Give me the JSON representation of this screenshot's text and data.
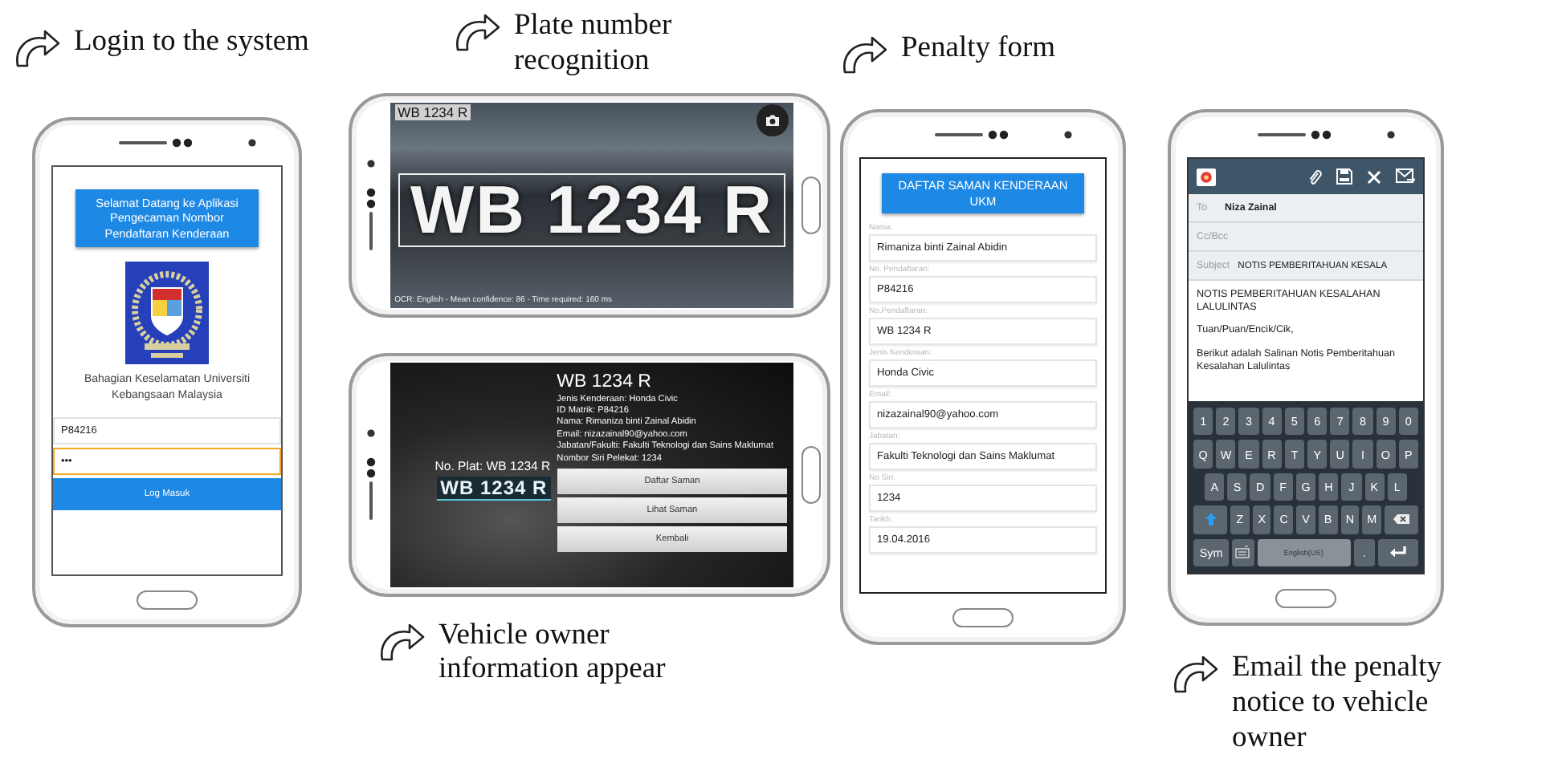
{
  "login": {
    "caption": "Login to the system",
    "banner": "Selamat Datang ke Aplikasi Pengecaman Nombor Pendaftaran Kenderaan",
    "organization": "Bahagian Keselamatan Universiti Kebangsaan Malaysia",
    "fields": [
      {
        "value": "P84216",
        "focused": false
      },
      {
        "value": "•••",
        "focused": true
      }
    ],
    "button": "Log Masuk"
  },
  "recognition": {
    "caption": "Plate number\nrecognition",
    "result_label": "WB 1234 R",
    "plate": "WB 1234 R",
    "status": "OCR: English - Mean confidence: 86 - Time required: 160 ms"
  },
  "owner_info": {
    "caption": "Vehicle owner\ninformation appear",
    "plate_label": "No. Plat: WB 1234 R",
    "plate_crop": "WB 1234 R",
    "title": "WB 1234 R",
    "details": [
      "Jenis Kenderaan: Honda Civic",
      "ID Matrik: P84216",
      "Nama: Rimaniza binti Zainal Abidin",
      "Email: nizazainal90@yahoo.com",
      "Jabatan/Fakulti: Fakulti Teknologi dan Sains Maklumat",
      "Nombor Siri Pelekat: 1234"
    ],
    "buttons": [
      "Daftar Saman",
      "Lihat Saman",
      "Kembali"
    ]
  },
  "penalty_form": {
    "caption": "Penalty form",
    "title": "DAFTAR SAMAN KENDERAAN UKM",
    "fields": [
      {
        "label": "Nama:",
        "value": "Rimaniza binti Zainal Abidin"
      },
      {
        "label": "No. Pendaftaran:",
        "value": "P84216"
      },
      {
        "label": "No.Pendaftaran:",
        "value": "WB 1234 R"
      },
      {
        "label": "Jenis Kenderaan:",
        "value": "Honda Civic"
      },
      {
        "label": "Email:",
        "value": "nizazainal90@yahoo.com"
      },
      {
        "label": "Jabatan:",
        "value": "Fakulti Teknologi dan Sains Maklumat"
      },
      {
        "label": "No Siri:",
        "value": "1234"
      },
      {
        "label": "Tarikh:",
        "value": "19.04.2016"
      }
    ]
  },
  "email": {
    "caption": "Email the penalty\nnotice to vehicle\nowner",
    "to_label": "To",
    "to": "Niza Zainal",
    "cc_label": "Cc/Bcc",
    "subject_label": "Subject",
    "subject": "NOTIS PEMBERITAHUAN KESALA",
    "body": [
      "NOTIS PEMBERITAHUAN KESALAHAN LALULINTAS",
      "Tuan/Puan/Encik/Cik,",
      "Berikut adalah Salinan Notis Pemberitahuan Kesalahan Lalulintas"
    ],
    "keyboard": [
      [
        {
          "kind": "char",
          "label": "1"
        },
        {
          "kind": "char",
          "label": "2"
        },
        {
          "kind": "char",
          "label": "3"
        },
        {
          "kind": "char",
          "label": "4"
        },
        {
          "kind": "char",
          "label": "5"
        },
        {
          "kind": "char",
          "label": "6"
        },
        {
          "kind": "char",
          "label": "7"
        },
        {
          "kind": "char",
          "label": "8"
        },
        {
          "kind": "char",
          "label": "9"
        },
        {
          "kind": "char",
          "label": "0"
        }
      ],
      [
        {
          "kind": "char",
          "label": "Q"
        },
        {
          "kind": "char",
          "label": "W"
        },
        {
          "kind": "char",
          "label": "E"
        },
        {
          "kind": "char",
          "label": "R"
        },
        {
          "kind": "char",
          "label": "T"
        },
        {
          "kind": "char",
          "label": "Y"
        },
        {
          "kind": "char",
          "label": "U"
        },
        {
          "kind": "char",
          "label": "I"
        },
        {
          "kind": "char",
          "label": "O"
        },
        {
          "kind": "char",
          "label": "P"
        }
      ],
      [
        {
          "kind": "char",
          "label": "A"
        },
        {
          "kind": "char",
          "label": "S"
        },
        {
          "kind": "char",
          "label": "D"
        },
        {
          "kind": "char",
          "label": "F"
        },
        {
          "kind": "char",
          "label": "G"
        },
        {
          "kind": "char",
          "label": "H"
        },
        {
          "kind": "char",
          "label": "J"
        },
        {
          "kind": "char",
          "label": "K"
        },
        {
          "kind": "char",
          "label": "L"
        }
      ],
      [
        {
          "kind": "shift"
        },
        {
          "kind": "char",
          "label": "Z"
        },
        {
          "kind": "char",
          "label": "X"
        },
        {
          "kind": "char",
          "label": "C"
        },
        {
          "kind": "char",
          "label": "V"
        },
        {
          "kind": "char",
          "label": "B"
        },
        {
          "kind": "char",
          "label": "N"
        },
        {
          "kind": "char",
          "label": "M"
        },
        {
          "kind": "backspace"
        }
      ],
      [
        {
          "kind": "wide",
          "label": "Sym"
        },
        {
          "kind": "keyboard"
        },
        {
          "kind": "space",
          "label": "English(US)"
        },
        {
          "kind": "char",
          "label": "."
        },
        {
          "kind": "enter"
        }
      ]
    ]
  }
}
